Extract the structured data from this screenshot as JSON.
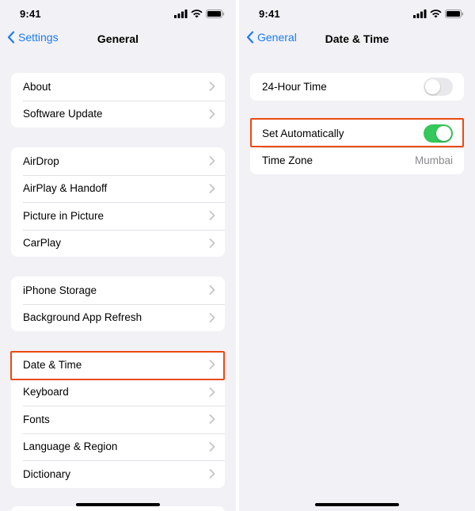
{
  "left": {
    "status": {
      "time": "9:41"
    },
    "nav": {
      "back_label": "Settings",
      "title": "General"
    },
    "groups": [
      {
        "rows": [
          "About",
          "Software Update"
        ]
      },
      {
        "rows": [
          "AirDrop",
          "AirPlay & Handoff",
          "Picture in Picture",
          "CarPlay"
        ]
      },
      {
        "rows": [
          "iPhone Storage",
          "Background App Refresh"
        ]
      },
      {
        "rows": [
          "Date & Time",
          "Keyboard",
          "Fonts",
          "Language & Region",
          "Dictionary"
        ]
      }
    ],
    "highlighted_row": "Date & Time"
  },
  "right": {
    "status": {
      "time": "9:41"
    },
    "nav": {
      "back_label": "General",
      "title": "Date & Time"
    },
    "hour24": {
      "label": "24-Hour Time",
      "on": false
    },
    "set_auto": {
      "label": "Set Automatically",
      "on": true
    },
    "time_zone": {
      "label": "Time Zone",
      "value": "Mumbai"
    },
    "highlighted_row": "Set Automatically"
  },
  "colors": {
    "accent": "#1a7cf5",
    "toggle_on": "#34c759",
    "highlight": "#ea4a12",
    "background": "#f2f1f6"
  },
  "icons": [
    "signal-icon",
    "wifi-icon",
    "battery-icon",
    "chevron-left-icon",
    "chevron-right-icon"
  ]
}
